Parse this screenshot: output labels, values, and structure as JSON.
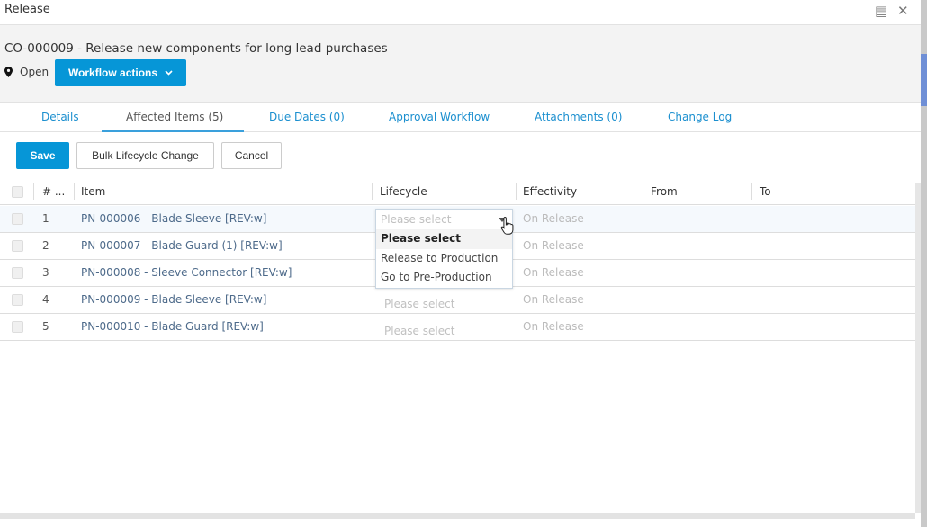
{
  "window": {
    "title": "Release",
    "maximize_icon": "maximize-icon",
    "close_icon": "close-icon"
  },
  "header": {
    "title": "CO-000009 - Release new components for long lead purchases",
    "status": "Open",
    "workflow_button": "Workflow actions"
  },
  "tabs": [
    {
      "label": "Details"
    },
    {
      "label": "Affected Items (5)",
      "active": true
    },
    {
      "label": "Due Dates (0)"
    },
    {
      "label": "Approval Workflow"
    },
    {
      "label": "Attachments (0)"
    },
    {
      "label": "Change Log"
    }
  ],
  "toolbar": {
    "save": "Save",
    "bulk": "Bulk Lifecycle Change",
    "cancel": "Cancel"
  },
  "columns": [
    "# ...",
    "Item",
    "Lifecycle",
    "Effectivity",
    "From",
    "To"
  ],
  "rows": [
    {
      "num": "1",
      "item": "PN-000006 - Blade Sleeve [REV:w]",
      "lifecycle": "Please select",
      "effectivity": "On Release"
    },
    {
      "num": "2",
      "item": "PN-000007 - Blade Guard (1) [REV:w]",
      "lifecycle": "Please select",
      "effectivity": "On Release"
    },
    {
      "num": "3",
      "item": "PN-000008 - Sleeve Connector [REV:w]",
      "lifecycle": "Please select",
      "effectivity": "On Release"
    },
    {
      "num": "4",
      "item": "PN-000009 - Blade Sleeve [REV:w]",
      "lifecycle": "Please select",
      "effectivity": "On Release"
    },
    {
      "num": "5",
      "item": "PN-000010 - Blade Guard [REV:w]",
      "lifecycle": "Please select",
      "effectivity": "On Release"
    }
  ],
  "dropdown": {
    "placeholder": "Please select",
    "options": [
      "Please select",
      "Release to Production",
      "Go to Pre-Production"
    ],
    "highlighted": "Please select"
  },
  "colors": {
    "accent": "#0696d7",
    "link": "#1b8fcf"
  }
}
